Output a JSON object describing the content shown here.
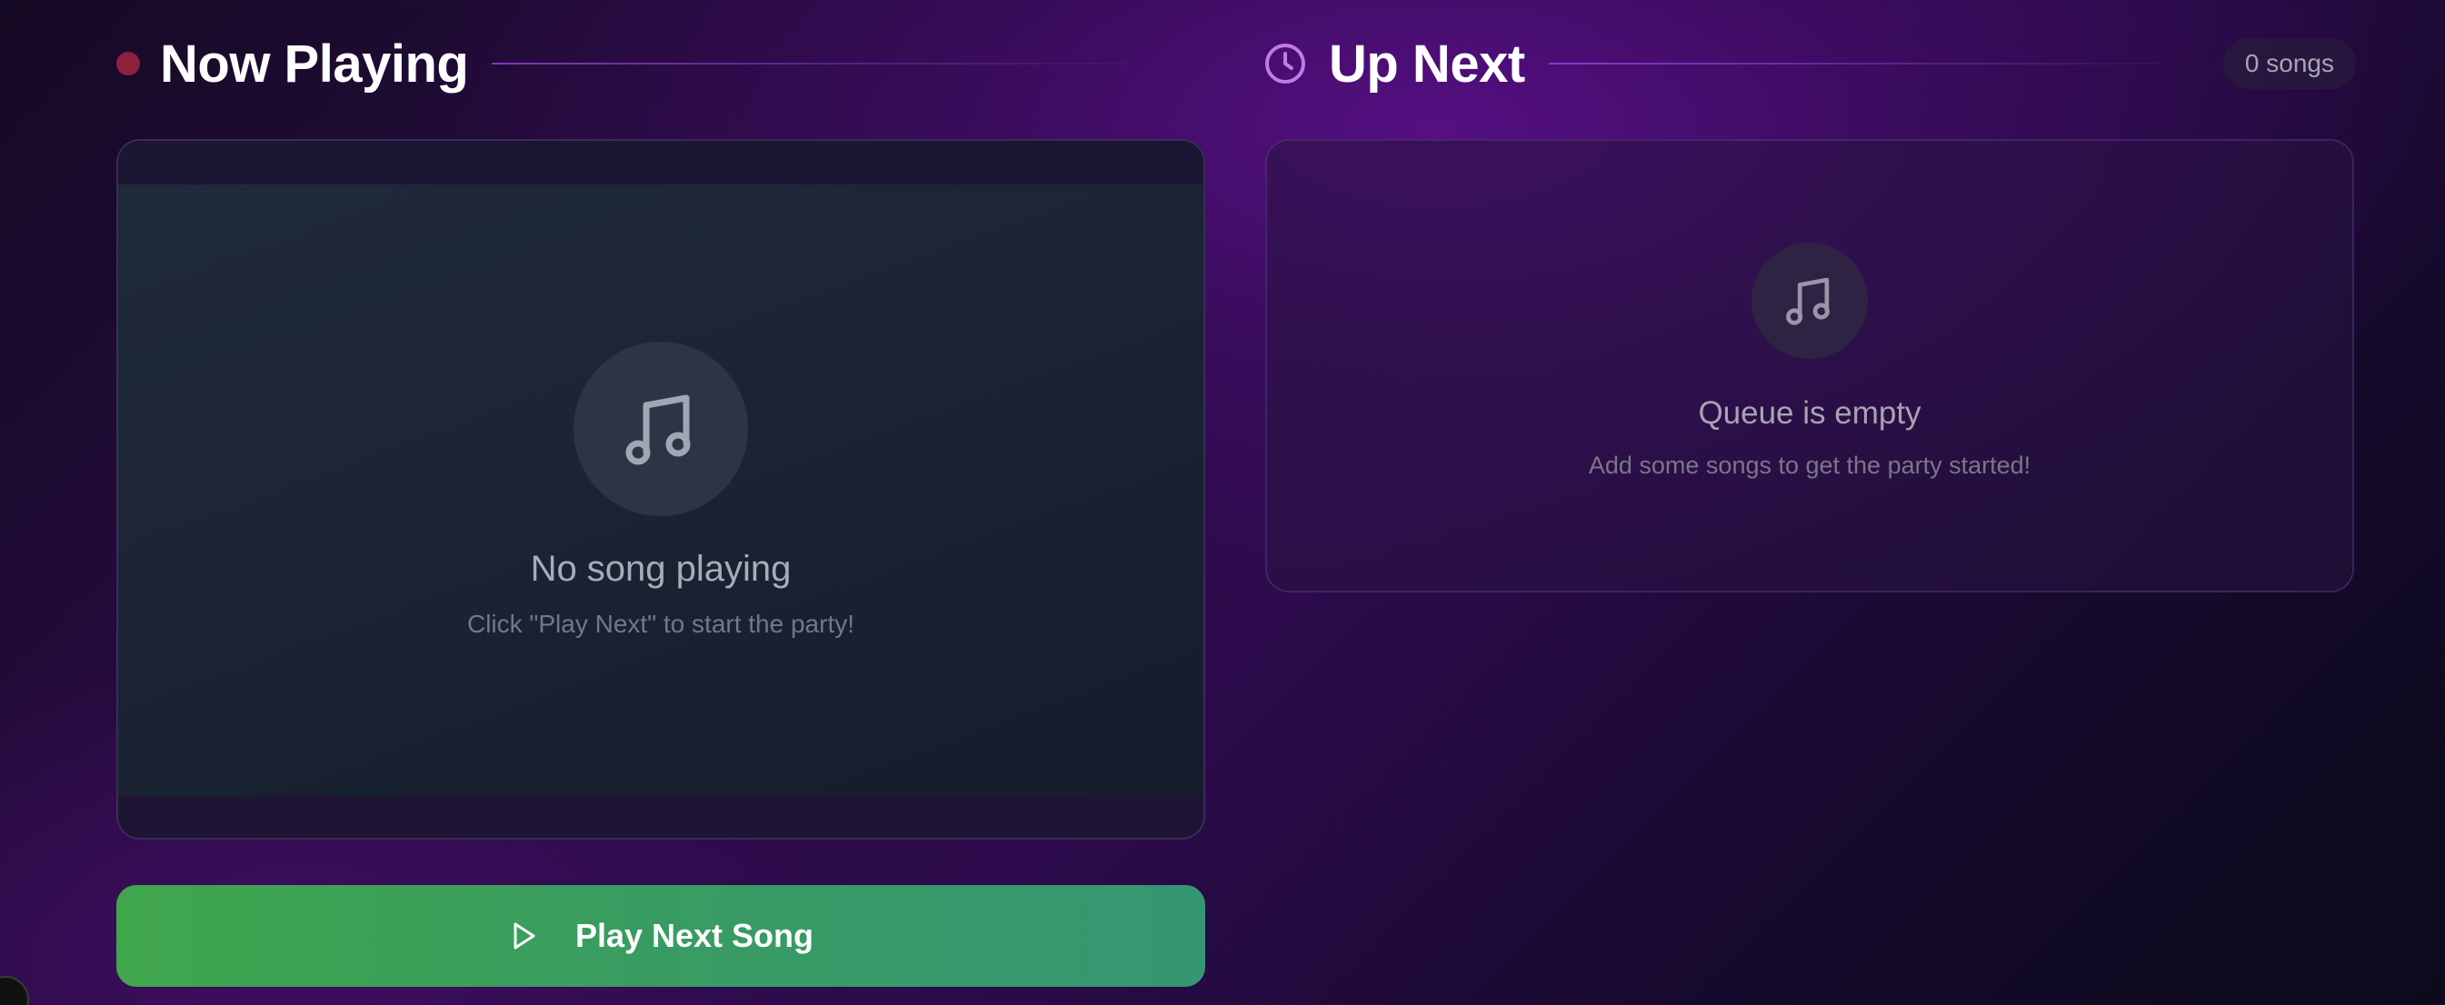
{
  "now_playing": {
    "title": "Now Playing",
    "empty_title": "No song playing",
    "empty_subtitle": "Click \"Play Next\" to start the party!",
    "play_button_label": "Play Next Song",
    "live_dot_color": "#8f1f3e"
  },
  "up_next": {
    "title": "Up Next",
    "count_label": "0 songs",
    "empty_title": "Queue is empty",
    "empty_subtitle": "Add some songs to get the party started!",
    "accent_color": "#c07be8"
  },
  "icons": {
    "header_left": "recording-dot-icon",
    "header_right": "clock-icon",
    "player_placeholder": "music-note-icon",
    "queue_placeholder": "music-note-icon",
    "play_button": "play-icon"
  },
  "colors": {
    "play_button_start": "#40a64c",
    "play_button_end": "#369673",
    "background_deep": "#150a24",
    "background_glow": "#5c108c"
  }
}
